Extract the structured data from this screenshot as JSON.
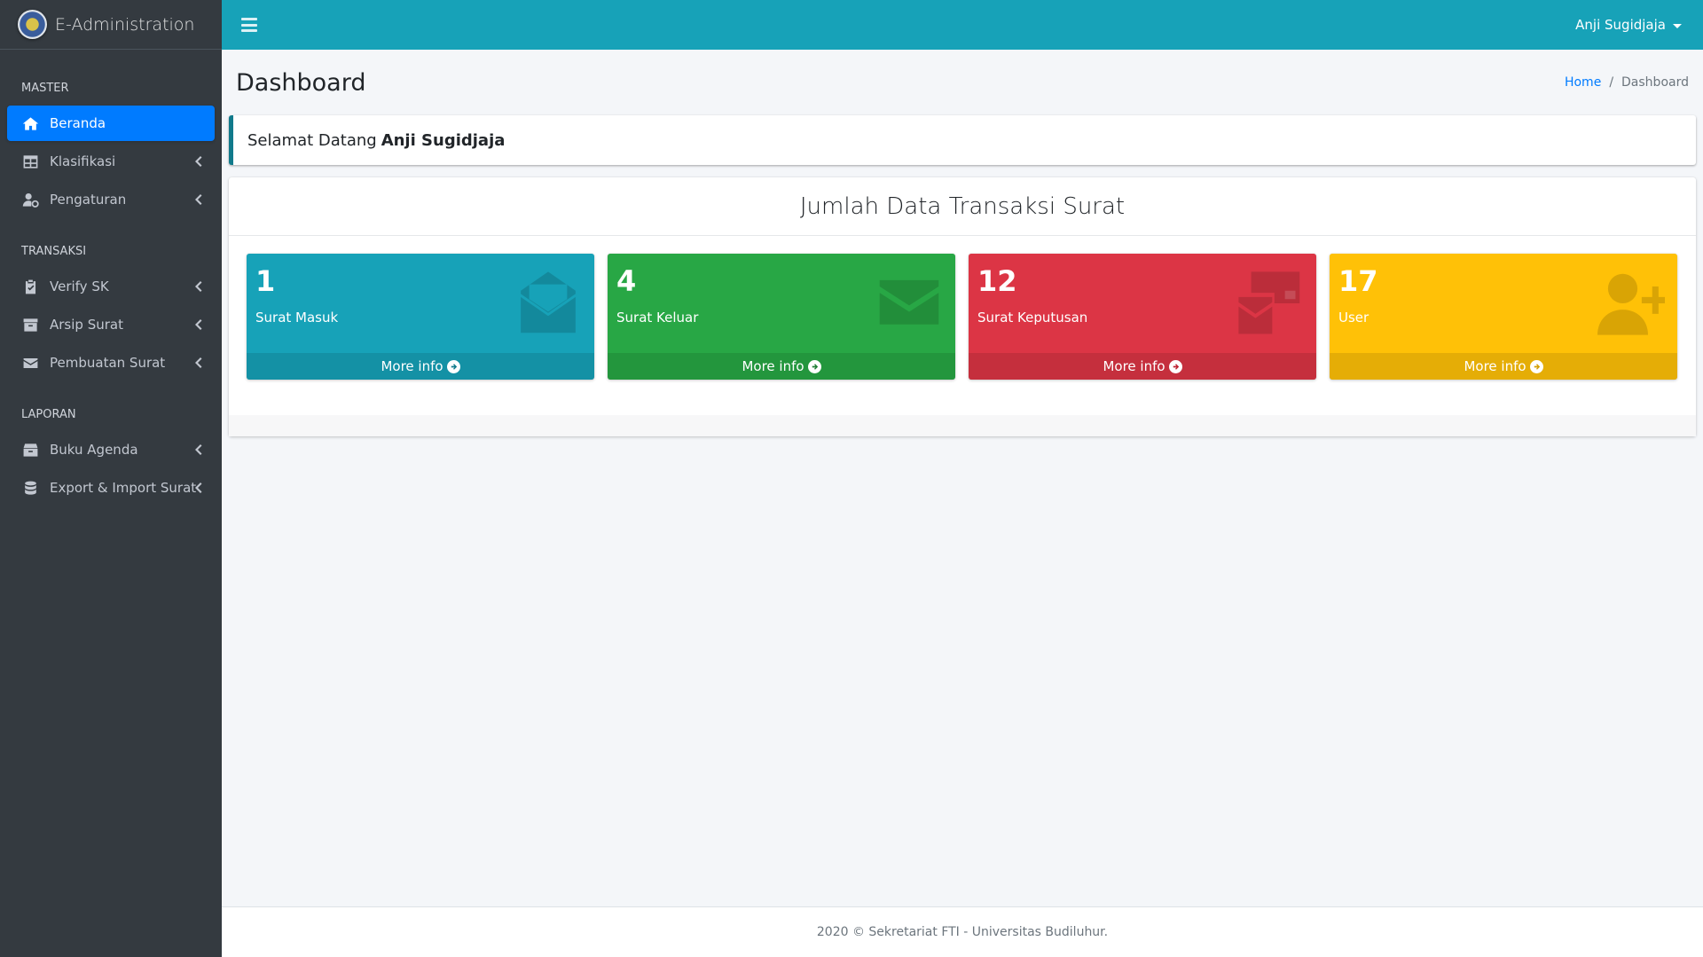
{
  "brand": {
    "name": "E-Administration",
    "logo_icon": "university-logo"
  },
  "topbar": {
    "user_name": "Anji Sugidjaja",
    "bg_color": "#17a2b8"
  },
  "sidebar": {
    "sections": [
      {
        "header": "MASTER",
        "items": [
          {
            "label": "Beranda",
            "icon": "home-icon",
            "active": true,
            "has_submenu": false
          },
          {
            "label": "Klasifikasi",
            "icon": "table-icon",
            "active": false,
            "has_submenu": true
          },
          {
            "label": "Pengaturan",
            "icon": "user-cog-icon",
            "active": false,
            "has_submenu": true
          }
        ]
      },
      {
        "header": "TRANSAKSI",
        "items": [
          {
            "label": "Verify SK",
            "icon": "clipboard-check-icon",
            "active": false,
            "has_submenu": true
          },
          {
            "label": "Arsip Surat",
            "icon": "archive-icon",
            "active": false,
            "has_submenu": true
          },
          {
            "label": "Pembuatan Surat",
            "icon": "envelope-icon",
            "active": false,
            "has_submenu": true
          }
        ]
      },
      {
        "header": "LAPORAN",
        "items": [
          {
            "label": "Buku Agenda",
            "icon": "box-icon",
            "active": false,
            "has_submenu": true
          },
          {
            "label": "Export & Import Surat",
            "icon": "database-icon",
            "active": false,
            "has_submenu": true
          }
        ]
      }
    ]
  },
  "page": {
    "title": "Dashboard",
    "breadcrumb": {
      "home": "Home",
      "current": "Dashboard"
    }
  },
  "welcome": {
    "prefix": "Selamat Datang",
    "name": "Anji Sugidjaja"
  },
  "stats_card": {
    "title": "Jumlah Data Transaksi Surat",
    "boxes": [
      {
        "count": "1",
        "label": "Surat Masuk",
        "more": "More info",
        "color": "#17a2b8",
        "icon": "envelope-open-text-icon"
      },
      {
        "count": "4",
        "label": "Surat Keluar",
        "more": "More info",
        "color": "#28a745",
        "icon": "envelope-icon"
      },
      {
        "count": "12",
        "label": "Surat Keputusan",
        "more": "More info",
        "color": "#dc3545",
        "icon": "mail-bulk-icon"
      },
      {
        "count": "17",
        "label": "User",
        "more": "More info",
        "color": "#ffc107",
        "icon": "user-plus-icon"
      }
    ]
  },
  "footer": {
    "text": "2020 © Sekretariat FTI - Universitas Budiluhur."
  }
}
